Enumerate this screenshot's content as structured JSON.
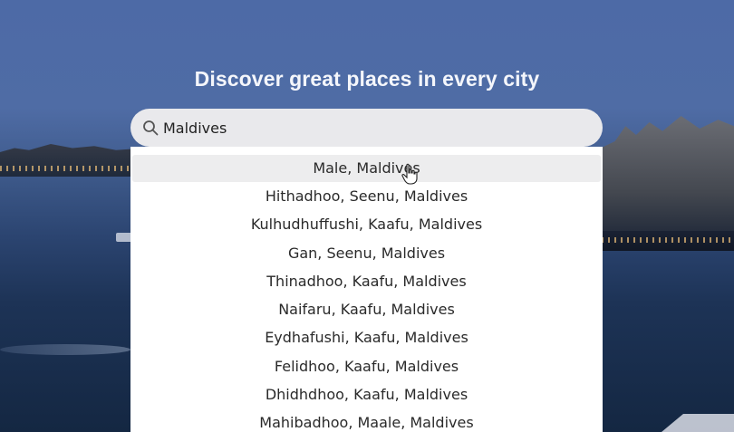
{
  "hero": {
    "headline": "Discover great places in every city"
  },
  "search": {
    "value": "Maldives",
    "icon": "search-icon"
  },
  "suggestions": [
    "Male, Maldives",
    "Hithadhoo, Seenu, Maldives",
    "Kulhudhuffushi, Kaafu, Maldives",
    "Gan, Seenu, Maldives",
    "Thinadhoo, Kaafu, Maldives",
    "Naifaru, Kaafu, Maldives",
    "Eydhafushi, Kaafu, Maldives",
    "Felidhoo, Kaafu, Maldives",
    "Dhidhdhoo, Kaafu, Maldives",
    "Mahibadhoo, Maale, Maldives"
  ],
  "colors": {
    "search_bg": "#e9e9ec",
    "highlight": "#ededee",
    "headline": "#f4f6fb"
  }
}
